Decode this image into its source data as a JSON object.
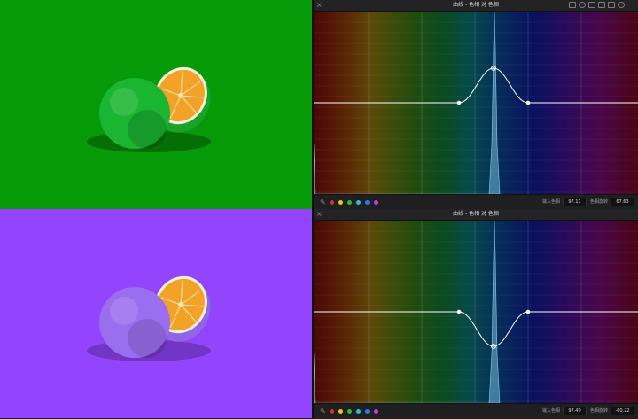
{
  "panel_title": "曲线 - 色相 对 色相",
  "window_icons": [
    "viewer-icon",
    "shape-icon",
    "qualifier-icon",
    "mode-icon",
    "grid-icon",
    "reset-icon",
    "more-icon"
  ],
  "swatches": [
    {
      "name": "red",
      "color": "#e0302a"
    },
    {
      "name": "yellow",
      "color": "#e6c41f"
    },
    {
      "name": "green",
      "color": "#2fb83c"
    },
    {
      "name": "cyan",
      "color": "#2db9d4"
    },
    {
      "name": "blue",
      "color": "#3b6ee8"
    },
    {
      "name": "magenta",
      "color": "#c43bd8"
    }
  ],
  "rows": [
    {
      "photo": {
        "background": "#079a08",
        "orange_body": "#1ab531",
        "orange_flesh": "#f2a227",
        "orange_rind": "#1aa32a"
      },
      "curve": {
        "direction": "up"
      },
      "input_hue_label": "输入色相",
      "input_hue_value": "97.11",
      "hue_rotate_label": "色相旋转",
      "hue_rotate_value": "67.63"
    },
    {
      "photo": {
        "background": "#9345fd",
        "orange_body": "#9b6ef0",
        "orange_flesh": "#f2a227",
        "orange_rind": "#8f66e6"
      },
      "curve": {
        "direction": "down"
      },
      "input_hue_label": "输入色相",
      "input_hue_value": "97.49",
      "hue_rotate_label": "色相旋转",
      "hue_rotate_value": "-60.22"
    }
  ]
}
